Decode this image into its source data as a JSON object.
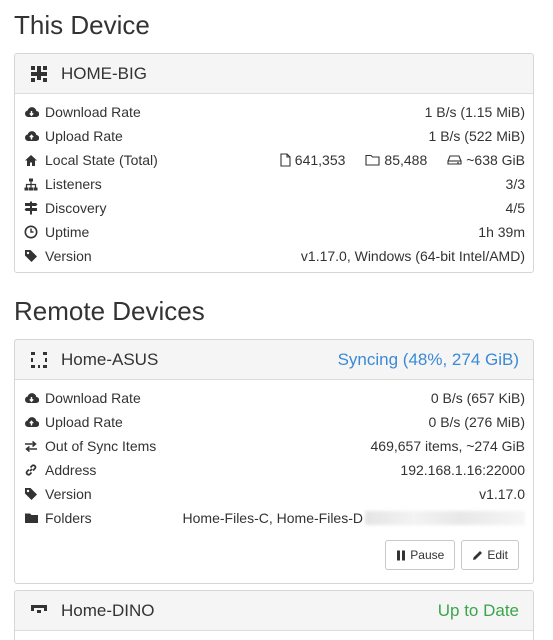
{
  "this_device": {
    "section_title": "This Device",
    "name": "HOME-BIG",
    "rows": [
      {
        "label": "Download Rate",
        "value": "1 B/s (1.15 MiB)",
        "icon": "cloud-download-icon"
      },
      {
        "label": "Upload Rate",
        "value": "1 B/s (522 MiB)",
        "icon": "cloud-upload-icon"
      },
      {
        "label": "Local State (Total)",
        "icon": "home-icon",
        "files": "641,353",
        "folders": "85,488",
        "size": "~638 GiB"
      },
      {
        "label": "Listeners",
        "value": "3/3",
        "icon": "sitemap-icon"
      },
      {
        "label": "Discovery",
        "value": "4/5",
        "icon": "signpost-icon"
      },
      {
        "label": "Uptime",
        "value": "1h 39m",
        "icon": "clock-icon"
      },
      {
        "label": "Version",
        "value": "v1.17.0, Windows (64-bit Intel/AMD)",
        "icon": "tag-icon"
      }
    ]
  },
  "remote": {
    "section_title": "Remote Devices",
    "devices": [
      {
        "name": "Home-ASUS",
        "status": "Syncing (48%, 274 GiB)",
        "sync_progress": 0.48,
        "rows": [
          {
            "label": "Download Rate",
            "value": "0 B/s (657 KiB)",
            "icon": "cloud-download-icon"
          },
          {
            "label": "Upload Rate",
            "value": "0 B/s (276 MiB)",
            "icon": "cloud-upload-icon"
          },
          {
            "label": "Out of Sync Items",
            "value": "469,657 items, ~274 GiB",
            "icon": "exchange-icon"
          },
          {
            "label": "Address",
            "value": "192.168.1.16:22000",
            "icon": "link-icon"
          },
          {
            "label": "Version",
            "value": "v1.17.0",
            "icon": "tag-icon"
          },
          {
            "label": "Folders",
            "value": "Home-Files-C, Home-Files-D",
            "icon": "folder-icon"
          }
        ],
        "pause_label": "Pause",
        "edit_label": "Edit"
      },
      {
        "name": "Home-DINO",
        "status": "Up to Date"
      }
    ]
  },
  "colors": {
    "accent": "#3a8ad6",
    "ok": "#3aa64c",
    "header_bg": "#f5f5f5"
  }
}
